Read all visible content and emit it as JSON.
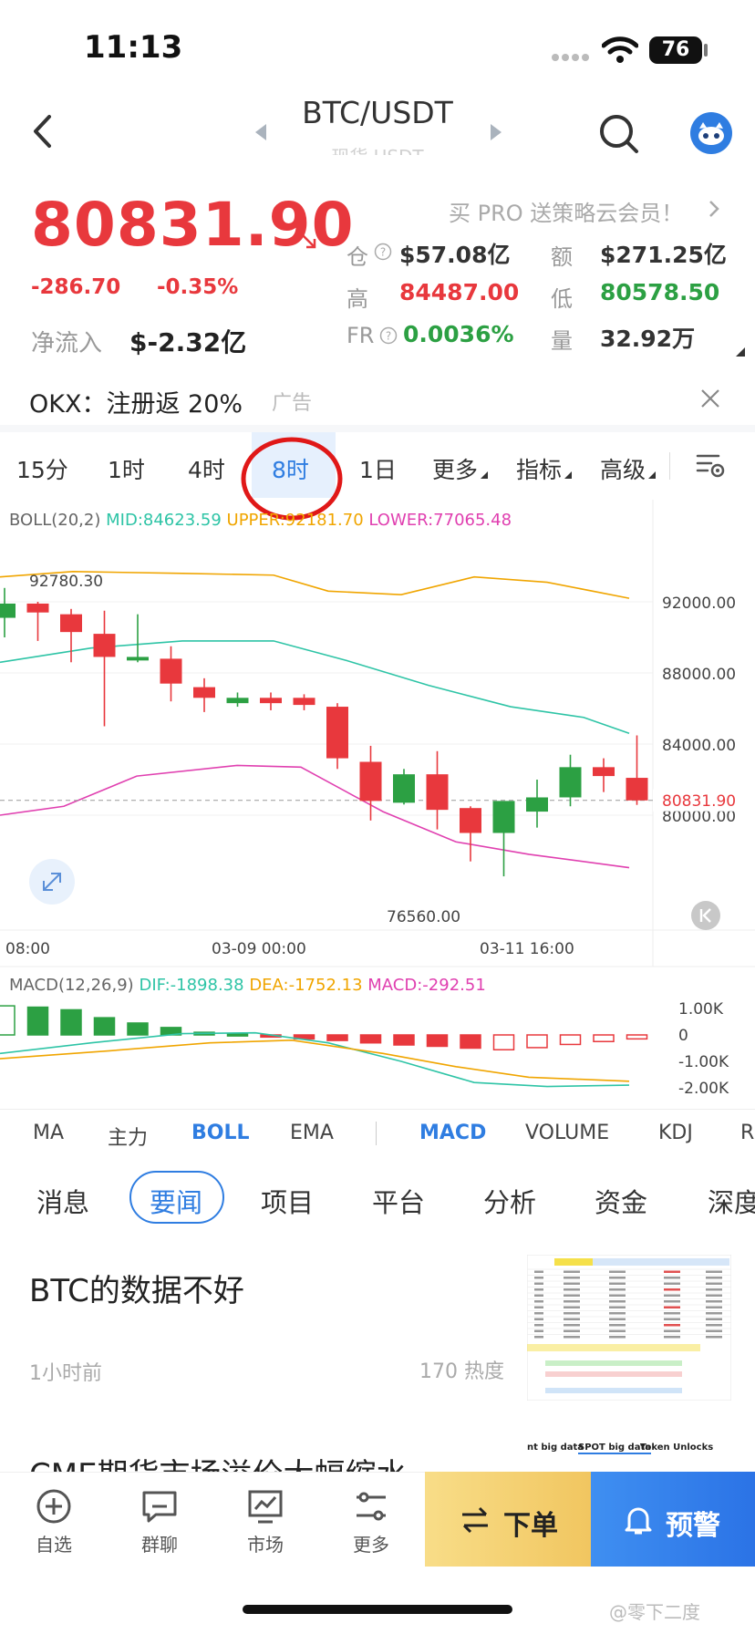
{
  "status": {
    "time": "11:13",
    "battery": "76"
  },
  "nav": {
    "pair": "BTC/USDT",
    "sub": "现货 USDT"
  },
  "price": {
    "last": "80831.90",
    "change": "-286.70",
    "change_pct": "-0.35%",
    "net_inflow_label": "净流入",
    "net_inflow": "$-2.32亿",
    "promo": "买 PRO 送策略云会员！"
  },
  "stats": {
    "oi_label": "仓",
    "oi": "$57.08亿",
    "amount_label": "额",
    "amount": "$271.25亿",
    "high_label": "高",
    "high": "84487.00",
    "low_label": "低",
    "low": "80578.50",
    "fr_label": "FR",
    "fr": "0.0036%",
    "volume_label": "量",
    "volume": "32.92万"
  },
  "ad": {
    "text": "OKX：注册返 20%",
    "tag": "广告"
  },
  "intervals": [
    "15分",
    "1时",
    "4时",
    "8时",
    "1日",
    "更多",
    "指标",
    "高级"
  ],
  "boll": {
    "label": "BOLL(20,2)",
    "mid": "MID:84623.59",
    "upper": "UPPER:92181.70",
    "lower": "LOWER:77065.48"
  },
  "chart": {
    "y_ticks": [
      "92000.00",
      "88000.00",
      "84000.00",
      "80000.00"
    ],
    "current_price_tag": "80831.90",
    "high_marker": "92780.30",
    "low_marker": "76560.00",
    "x_ticks": [
      "08:00",
      "03-09 00:00",
      "03-11 16:00"
    ]
  },
  "macd": {
    "label": "MACD(12,26,9)",
    "dif": "DIF:-1898.38",
    "dea": "DEA:-1752.13",
    "macd": "MACD:-292.51",
    "y_ticks": [
      "1.00K",
      "0",
      "-1.00K",
      "-2.00K"
    ]
  },
  "indicator_tabs": [
    "MA",
    "主力",
    "BOLL",
    "EMA",
    "MACD",
    "VOLUME",
    "KDJ",
    "R"
  ],
  "news_tabs": [
    "消息",
    "要闻",
    "项目",
    "平台",
    "分析",
    "资金",
    "深度"
  ],
  "news": [
    {
      "title": "BTC的数据不好",
      "time": "1小时前",
      "heat": "170 热度"
    },
    {
      "title": "CME期货市场溢价大幅缩水"
    }
  ],
  "thumb2_tabs": [
    "nt big data",
    "SPOT big data",
    "Token Unlocks"
  ],
  "bottom_nav": [
    "自选",
    "群聊",
    "市场",
    "更多"
  ],
  "actions": {
    "order": "下单",
    "alert": "预警"
  },
  "watermark": "@零下二度",
  "colors": {
    "up": "#2ca043",
    "down": "#e8383d",
    "accent": "#2f7de1",
    "upper": "#f0a500",
    "mid": "#2ec4a6",
    "lower": "#e040b0"
  }
}
